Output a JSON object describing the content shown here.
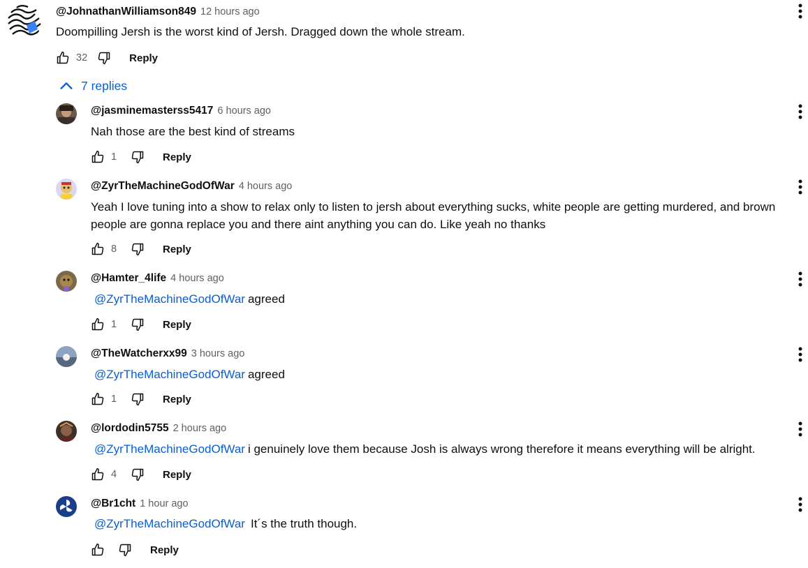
{
  "top": {
    "author": "@JohnathanWilliamson849",
    "time": "12 hours ago",
    "text": "Doompilling Jersh is the worst kind of Jersh. Dragged down the whole stream.",
    "likes": "32",
    "reply_label": "Reply",
    "avatar_icon": "swirl-pattern-avatar"
  },
  "replies_toggle": {
    "label": "7 replies",
    "icon": "chevron-up-icon"
  },
  "replies": [
    {
      "author": "@jasminemasterss5417",
      "time": "6 hours ago",
      "mention": "",
      "text": "Nah those are the best kind of streams",
      "likes": "1",
      "reply_label": "Reply",
      "avatar_color": "#5a4638"
    },
    {
      "author": "@ZyrTheMachineGodOfWar",
      "time": "4 hours ago",
      "mention": "",
      "text": "Yeah I love tuning into a show to relax only to listen to jersh about everything sucks, white people are getting murdered, and brown people are gonna replace you and there aint anything you can do. Like yeah no thanks",
      "likes": "8",
      "reply_label": "Reply",
      "avatar_color": "#d9d3f0"
    },
    {
      "author": "@Hamter_4life",
      "time": "4 hours ago",
      "mention": "@ZyrTheMachineGodOfWar",
      "text": "agreed",
      "likes": "1",
      "reply_label": "Reply",
      "avatar_color": "#6b5a3e"
    },
    {
      "author": "@TheWatcherxx99",
      "time": "3 hours ago",
      "mention": "@ZyrTheMachineGodOfWar",
      "text": "agreed",
      "likes": "1",
      "reply_label": "Reply",
      "avatar_color": "#7f8fa6"
    },
    {
      "author": "@lordodin5755",
      "time": "2 hours ago",
      "mention": "@ZyrTheMachineGodOfWar",
      "text": "i genuinely love them because Josh is always wrong therefore it means everything will be alright.",
      "likes": "4",
      "reply_label": "Reply",
      "avatar_color": "#4a3a32"
    },
    {
      "author": "@Br1cht",
      "time": "1 hour ago",
      "mention": "@ZyrTheMachineGodOfWar",
      "text": "It´s the truth though.",
      "likes": "",
      "reply_label": "Reply",
      "avatar_color": "#1a3f8a"
    }
  ],
  "icons": {
    "like": "thumb-up-icon",
    "dislike": "thumb-down-icon",
    "menu": "more-vert-icon"
  },
  "colors": {
    "link": "#065fd4",
    "text": "#0f0f0f",
    "meta": "#606060"
  }
}
